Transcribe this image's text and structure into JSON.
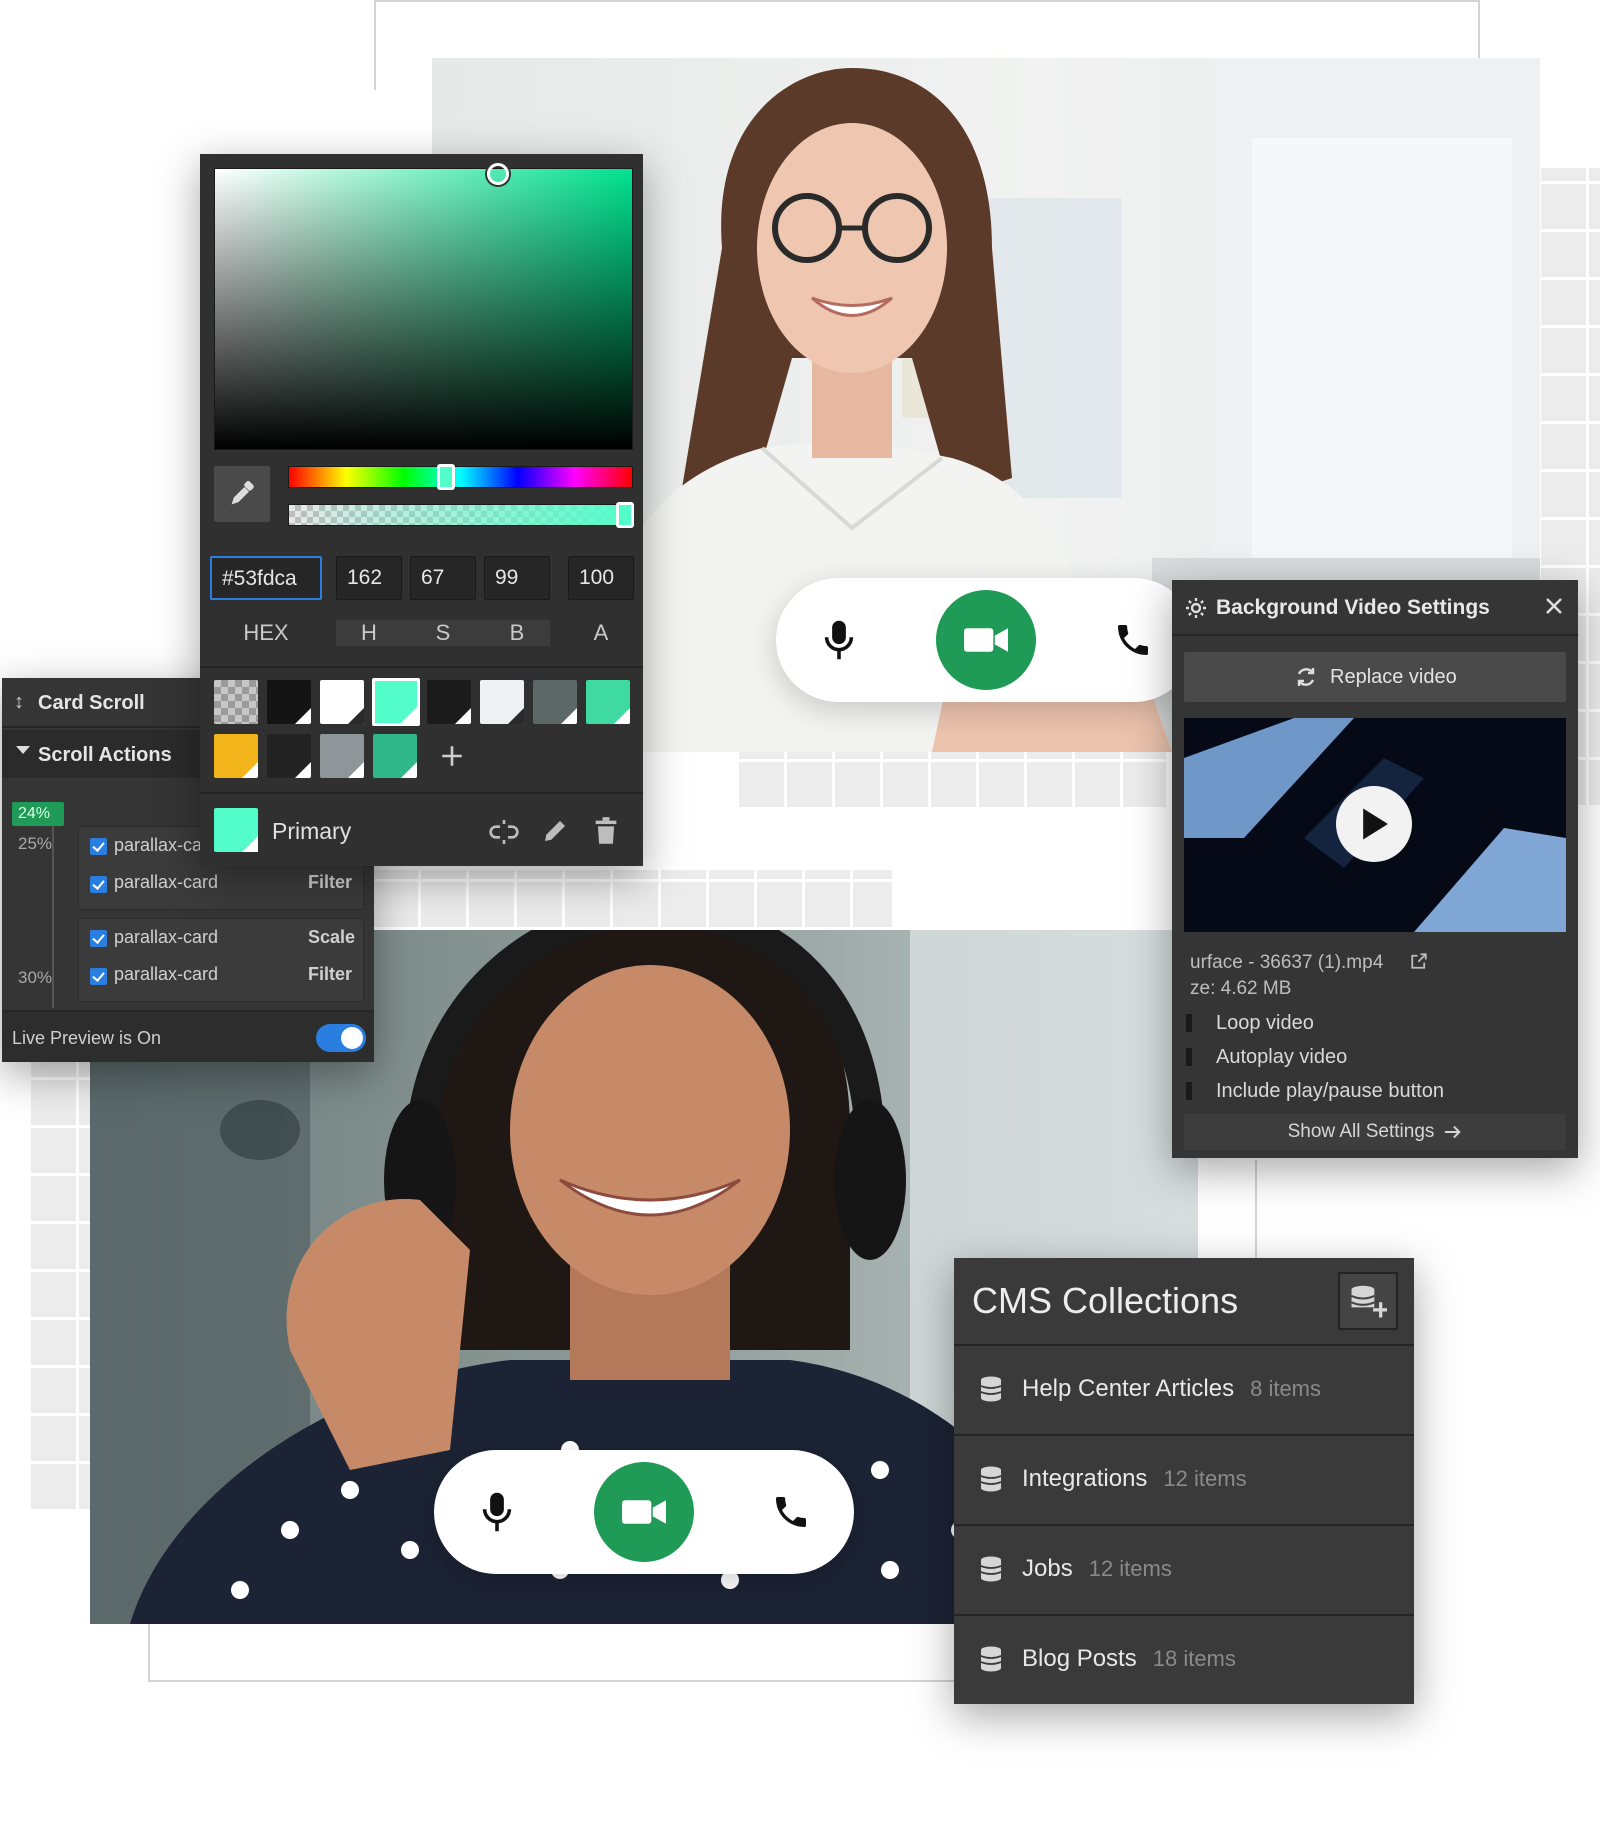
{
  "color_picker": {
    "hex_value": "#53fdca",
    "h": "162",
    "s": "67",
    "b": "99",
    "a": "100",
    "labels": {
      "hex": "HEX",
      "h": "H",
      "s": "S",
      "b": "B",
      "a": "A"
    },
    "swatch_name": "Primary",
    "current_color": "#53fdca"
  },
  "card_scroll": {
    "title": "Card Scroll",
    "section": "Scroll Actions",
    "badge": "24%",
    "marker_25": "25%",
    "marker_30": "30%",
    "rows": [
      {
        "name": "parallax-ca",
        "action": ""
      },
      {
        "name": "parallax-card",
        "action": "Filter"
      },
      {
        "name": "parallax-card",
        "action": "Scale"
      },
      {
        "name": "parallax-card",
        "action": "Filter"
      }
    ],
    "live_preview": "Live Preview is On"
  },
  "bg_video": {
    "title": "Background Video Settings",
    "replace": "Replace video",
    "filename": "urface - 36637 (1).mp4",
    "size": "ze: 4.62 MB",
    "loop": "Loop video",
    "autoplay": "Autoplay video",
    "playpause": "Include play/pause button",
    "show_all": "Show All Settings"
  },
  "cms": {
    "title": "CMS Collections",
    "collections": [
      {
        "name": "Help Center Articles",
        "count": "8 items"
      },
      {
        "name": "Integrations",
        "count": "12 items"
      },
      {
        "name": "Jobs",
        "count": "12 items"
      },
      {
        "name": "Blog Posts",
        "count": "18 items"
      }
    ]
  },
  "colors": {
    "accent_green": "#1f9b57",
    "toggle_blue": "#2a7ee0",
    "panel_bg": "#2f2f2f"
  }
}
